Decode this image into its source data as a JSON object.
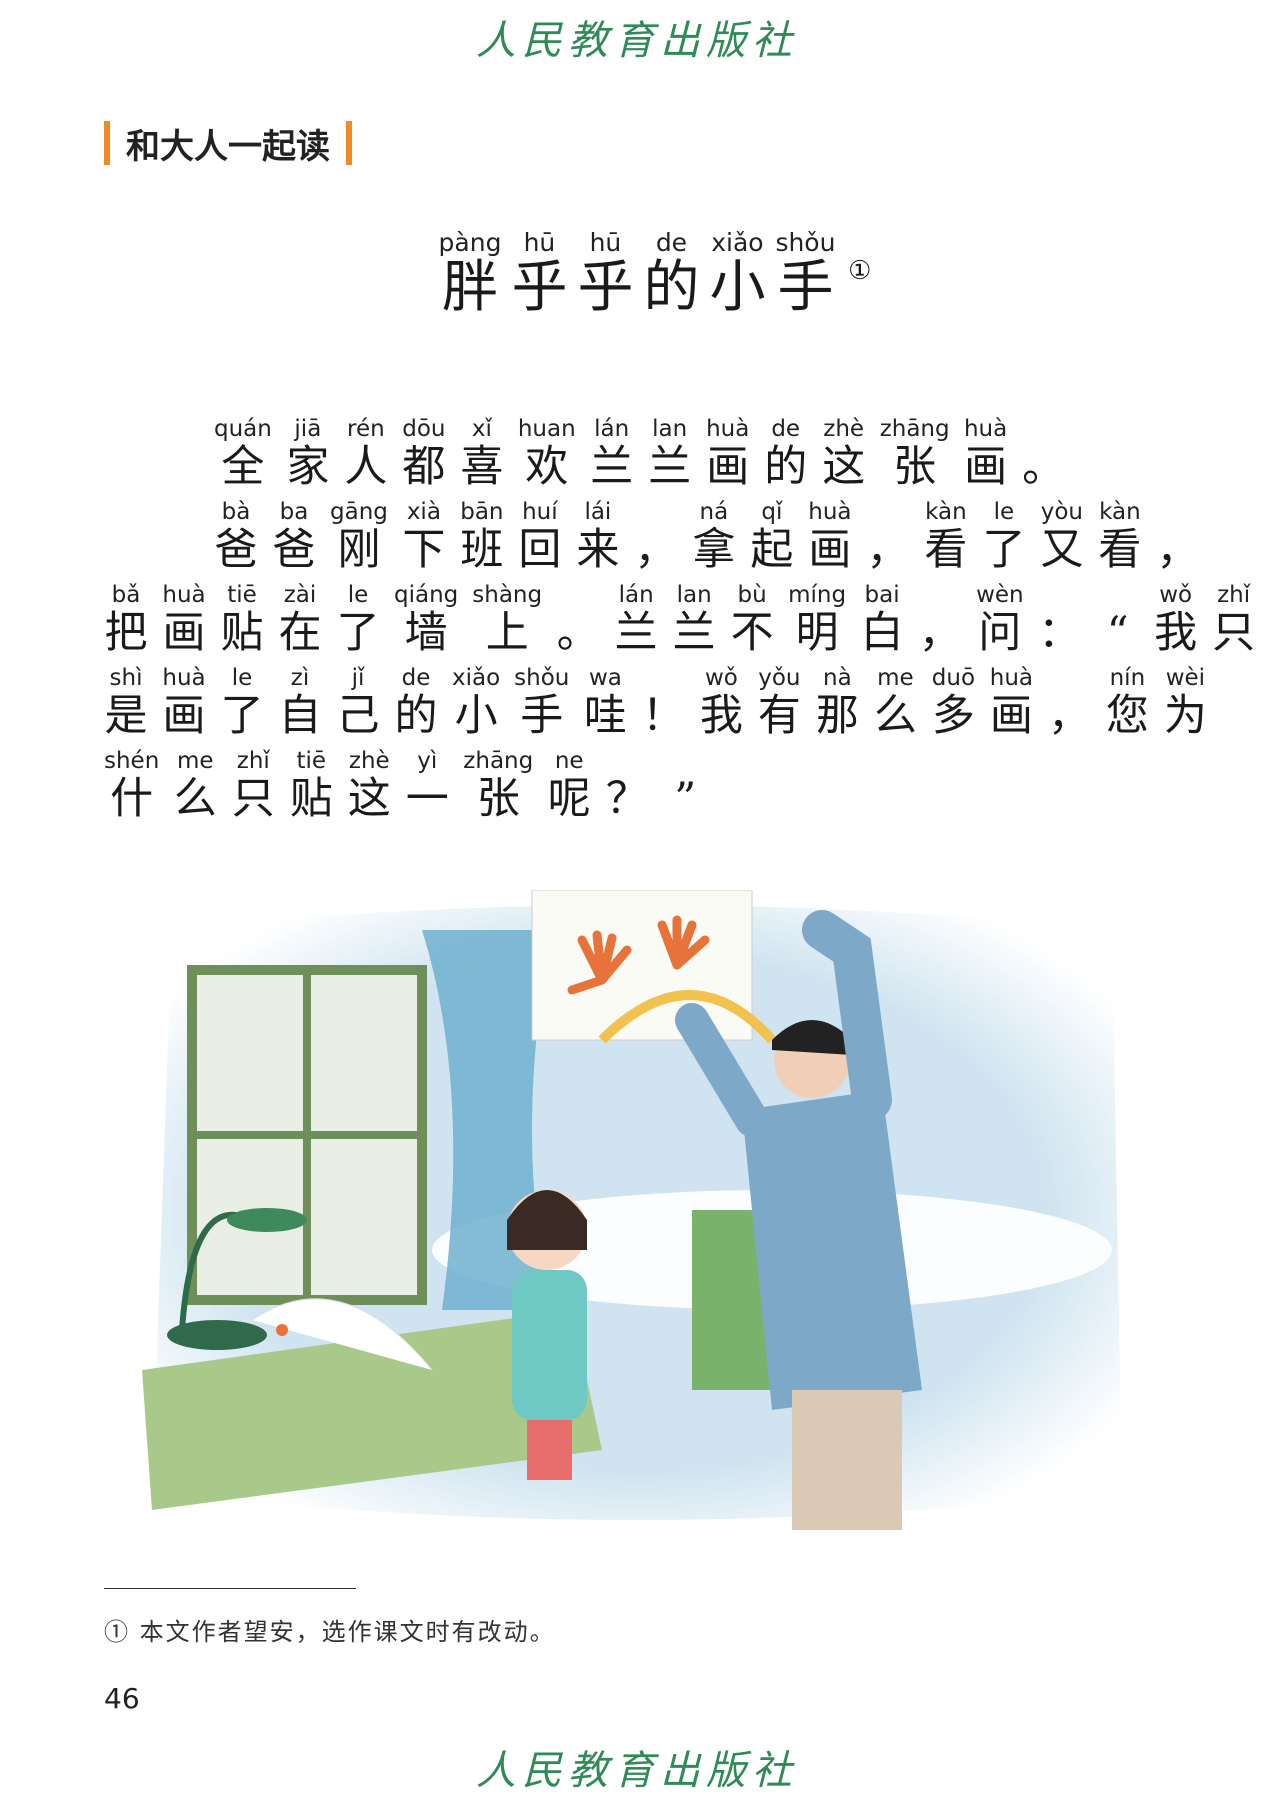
{
  "publisher": "人民教育出版社",
  "section_label": "和大人一起读",
  "title": {
    "chars": [
      {
        "py": "pàng",
        "hz": "胖"
      },
      {
        "py": "hū",
        "hz": "乎"
      },
      {
        "py": "hū",
        "hz": "乎"
      },
      {
        "py": "de",
        "hz": "的"
      },
      {
        "py": "xiǎo",
        "hz": "小"
      },
      {
        "py": "shǒu",
        "hz": "手"
      }
    ],
    "footnote_mark": "①"
  },
  "lines": [
    {
      "chars": [
        {
          "py": "quán",
          "hz": "全"
        },
        {
          "py": "jiā",
          "hz": "家"
        },
        {
          "py": "rén",
          "hz": "人"
        },
        {
          "py": "dōu",
          "hz": "都"
        },
        {
          "py": "xǐ",
          "hz": "喜"
        },
        {
          "py": "huan",
          "hz": "欢"
        },
        {
          "py": "lán",
          "hz": "兰"
        },
        {
          "py": "lan",
          "hz": "兰"
        },
        {
          "py": "huà",
          "hz": "画"
        },
        {
          "py": "de",
          "hz": "的"
        },
        {
          "py": "zhè",
          "hz": "这"
        },
        {
          "py": "zhāng",
          "hz": "张"
        },
        {
          "py": "huà",
          "hz": "画"
        },
        {
          "py": "",
          "hz": "。"
        }
      ]
    },
    {
      "chars": [
        {
          "py": "bà",
          "hz": "爸"
        },
        {
          "py": "ba",
          "hz": "爸"
        },
        {
          "py": "gāng",
          "hz": "刚"
        },
        {
          "py": "xià",
          "hz": "下"
        },
        {
          "py": "bān",
          "hz": "班"
        },
        {
          "py": "huí",
          "hz": "回"
        },
        {
          "py": "lái",
          "hz": "来"
        },
        {
          "py": "",
          "hz": "，"
        },
        {
          "py": "ná",
          "hz": "拿"
        },
        {
          "py": "qǐ",
          "hz": "起"
        },
        {
          "py": "huà",
          "hz": "画"
        },
        {
          "py": "",
          "hz": "，"
        },
        {
          "py": "kàn",
          "hz": "看"
        },
        {
          "py": "le",
          "hz": "了"
        },
        {
          "py": "yòu",
          "hz": "又"
        },
        {
          "py": "kàn",
          "hz": "看"
        },
        {
          "py": "",
          "hz": "，"
        }
      ]
    },
    {
      "chars": [
        {
          "py": "bǎ",
          "hz": "把"
        },
        {
          "py": "huà",
          "hz": "画"
        },
        {
          "py": "tiē",
          "hz": "贴"
        },
        {
          "py": "zài",
          "hz": "在"
        },
        {
          "py": "le",
          "hz": "了"
        },
        {
          "py": "qiáng",
          "hz": "墙"
        },
        {
          "py": "shàng",
          "hz": "上"
        },
        {
          "py": "",
          "hz": "。"
        },
        {
          "py": "lán",
          "hz": "兰"
        },
        {
          "py": "lan",
          "hz": "兰"
        },
        {
          "py": "bù",
          "hz": "不"
        },
        {
          "py": "míng",
          "hz": "明"
        },
        {
          "py": "bai",
          "hz": "白"
        },
        {
          "py": "",
          "hz": "，"
        },
        {
          "py": "wèn",
          "hz": "问"
        },
        {
          "py": "",
          "hz": "："
        },
        {
          "py": "",
          "hz": "“"
        },
        {
          "py": "wǒ",
          "hz": "我"
        },
        {
          "py": "zhǐ",
          "hz": "只"
        }
      ]
    },
    {
      "chars": [
        {
          "py": "shì",
          "hz": "是"
        },
        {
          "py": "huà",
          "hz": "画"
        },
        {
          "py": "le",
          "hz": "了"
        },
        {
          "py": "zì",
          "hz": "自"
        },
        {
          "py": "jǐ",
          "hz": "己"
        },
        {
          "py": "de",
          "hz": "的"
        },
        {
          "py": "xiǎo",
          "hz": "小"
        },
        {
          "py": "shǒu",
          "hz": "手"
        },
        {
          "py": "wa",
          "hz": "哇"
        },
        {
          "py": "",
          "hz": "！"
        },
        {
          "py": "wǒ",
          "hz": "我"
        },
        {
          "py": "yǒu",
          "hz": "有"
        },
        {
          "py": "nà",
          "hz": "那"
        },
        {
          "py": "me",
          "hz": "么"
        },
        {
          "py": "duō",
          "hz": "多"
        },
        {
          "py": "huà",
          "hz": "画"
        },
        {
          "py": "",
          "hz": "，"
        },
        {
          "py": "nín",
          "hz": "您"
        },
        {
          "py": "wèi",
          "hz": "为"
        }
      ]
    },
    {
      "chars": [
        {
          "py": "shén",
          "hz": "什"
        },
        {
          "py": "me",
          "hz": "么"
        },
        {
          "py": "zhǐ",
          "hz": "只"
        },
        {
          "py": "tiē",
          "hz": "贴"
        },
        {
          "py": "zhè",
          "hz": "这"
        },
        {
          "py": "yì",
          "hz": "一"
        },
        {
          "py": "zhāng",
          "hz": "张"
        },
        {
          "py": "ne",
          "hz": "呢"
        },
        {
          "py": "",
          "hz": "？"
        },
        {
          "py": "",
          "hz": "”"
        }
      ]
    }
  ],
  "footnote": "① 本文作者望安，选作课文时有改动。",
  "page_number": "46",
  "colors": {
    "brand": "#2f8a56",
    "accent": "#f08a24"
  }
}
